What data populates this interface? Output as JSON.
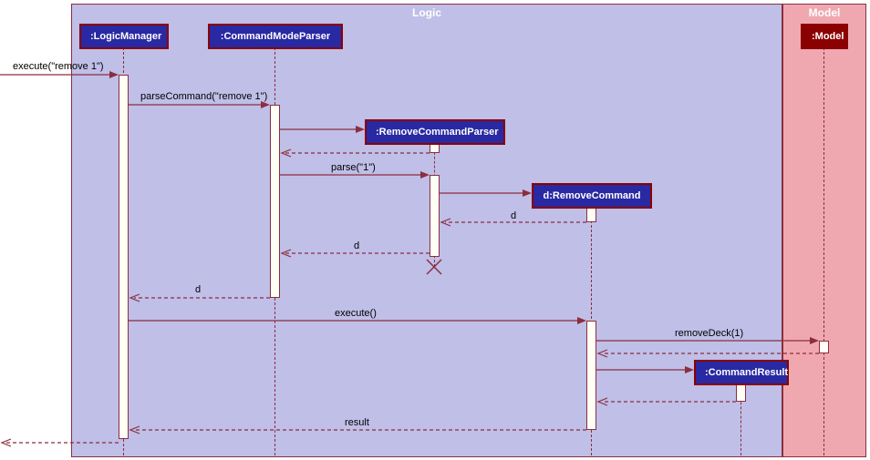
{
  "frames": {
    "logic": {
      "label": "Logic",
      "bg": "#bfbfe8",
      "border": "#8b2e3e",
      "labelColor": "#fff"
    },
    "model": {
      "label": "Model",
      "bg": "#f0a8b0",
      "border": "#8b2e3e",
      "labelColor": "#fff"
    }
  },
  "participants": {
    "logicManager": {
      "label": ":LogicManager",
      "bg": "#2929a3",
      "color": "#fff",
      "border": "#8b0000"
    },
    "commandModeParser": {
      "label": ":CommandModeParser",
      "bg": "#2929a3",
      "color": "#fff",
      "border": "#8b0000"
    },
    "removeCommandParser": {
      "label": ":RemoveCommandParser",
      "bg": "#2929a3",
      "color": "#fff",
      "border": "#8b0000"
    },
    "removeCommand": {
      "label": "d:RemoveCommand",
      "bg": "#2929a3",
      "color": "#fff",
      "border": "#8b0000"
    },
    "commandResult": {
      "label": ":CommandResult",
      "bg": "#2929a3",
      "color": "#fff",
      "border": "#8b0000"
    },
    "model": {
      "label": ":Model",
      "bg": "#8b0000",
      "color": "#fff",
      "border": "#8b0000"
    }
  },
  "messages": {
    "execute": "execute(\"remove 1\")",
    "parseCommand": "parseCommand(\"remove 1\")",
    "parse": "parse(\"1\")",
    "returnD1": "d",
    "returnD2": "d",
    "returnD3": "d",
    "executeCall": "execute()",
    "removeDeck": "removeDeck(1)",
    "result": "result"
  }
}
